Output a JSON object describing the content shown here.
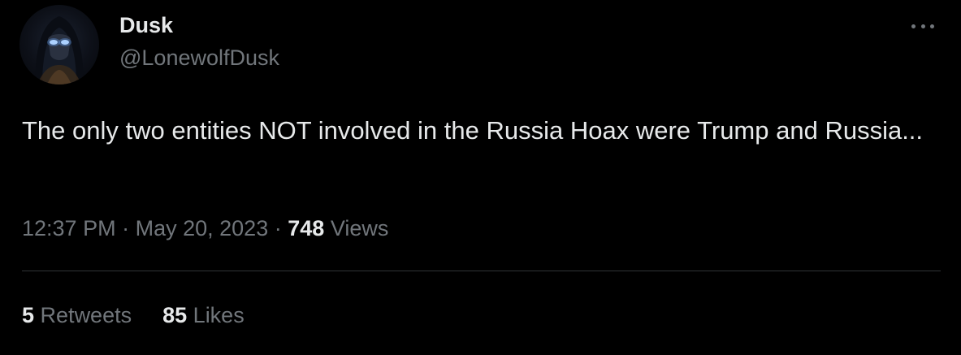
{
  "user": {
    "display_name": "Dusk",
    "handle": "@LonewolfDusk",
    "avatar_icon": "hooded-figure-avatar"
  },
  "tweet": {
    "text": "The only two entities NOT involved in the Russia Hoax were Trump and Russia...",
    "time": "12:37 PM",
    "date": "May 20, 2023",
    "separator": "·",
    "views_count": "748",
    "views_label": "Views"
  },
  "stats": {
    "retweets_count": "5",
    "retweets_label": "Retweets",
    "likes_count": "85",
    "likes_label": "Likes"
  },
  "icons": {
    "more": "more-options-icon"
  },
  "colors": {
    "background": "#000000",
    "primary_text": "#e7e9ea",
    "secondary_text": "#71767b",
    "divider": "#2f3336"
  }
}
